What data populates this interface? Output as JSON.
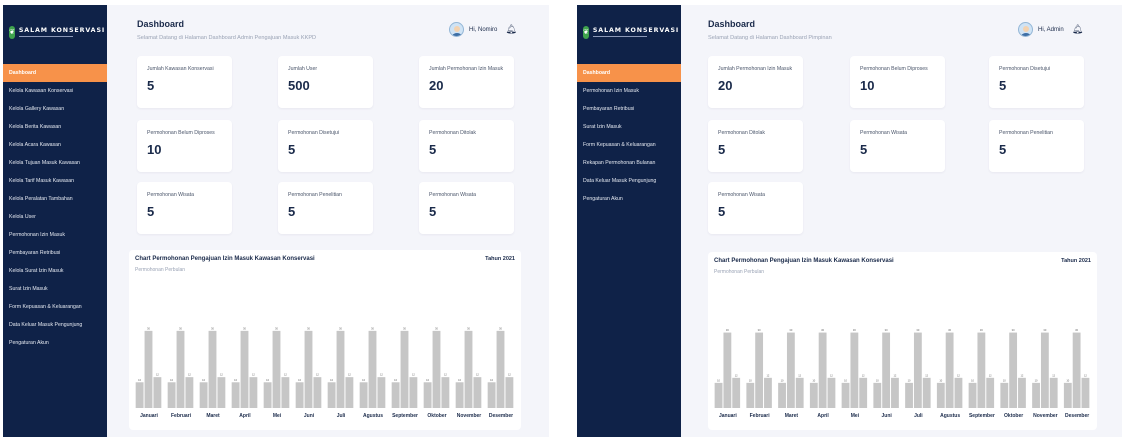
{
  "brand": {
    "name": "SALAM KONSERVASI",
    "logo_icon": "leaf-icon"
  },
  "colors": {
    "sidebar": "#0f2248",
    "active": "#f7924a",
    "bar": "#c6c6c6",
    "text": "#1a2a4a"
  },
  "panel1": {
    "title": "Dashboard",
    "subtitle": "Selamat Datang di Halaman Dashboard Admin Pengajuan Masuk KKPD",
    "greeting": "Hi, Nomiro",
    "menu": [
      "Dashboard",
      "Kelola Kawasan Konservasi",
      "Kelola Gallery Kawasan",
      "Kelola Berita Kawasan",
      "Kelola Acara Kawasan",
      "Kelola Tujuan Masuk Kawasan",
      "Kelola Tarif Masuk Kawasan",
      "Kelola Peralatan Tambahan",
      "Kelola User",
      "Permohonan Izin Masuk",
      "Pembayaran Retribusi",
      "Kelola Surat Izin Masuk",
      "Surat Izin Masuk",
      "Form Kepuasan & Keluarangan",
      "Data Keluar Masuk Pengunjung",
      "Pengaturan Akun"
    ],
    "cards": [
      {
        "label": "Jumlah Kawasan Konservasi",
        "value": "5"
      },
      {
        "label": "Jumlah User",
        "value": "500"
      },
      {
        "label": "Jumlah Permohonan Izin Masuk",
        "value": "20"
      },
      {
        "label": "Permohonan Belum Diproses",
        "value": "10"
      },
      {
        "label": "Permohonan Disetujui",
        "value": "5"
      },
      {
        "label": "Permohonan Ditolak",
        "value": "5"
      },
      {
        "label": "Permohonan Wisata",
        "value": "5"
      },
      {
        "label": "Permohonan Penelitian",
        "value": "5"
      },
      {
        "label": "Permohonan Wisata",
        "value": "5"
      }
    ],
    "chart_title": "Chart Permohonan Pengajuan Izin Masuk Kawasan Konservasi",
    "chart_year": "Tahun 2021",
    "chart_sub": "Permohonan Perbulan"
  },
  "panel2": {
    "title": "Dashboard",
    "subtitle": "Selamat Datang di Halaman Dashboard Pimpinan",
    "greeting": "Hi, Admin",
    "menu": [
      "Dashboard",
      "Permohonan Izin Masuk",
      "Pembayaran Retribusi",
      "Surat Izin Masuk",
      "Form Kepuasan & Keluarangan",
      "Rekapan Permohonan Bulanan",
      "Data Keluar Masuk Pengunjung",
      "Pengaturan Akun"
    ],
    "cards": [
      {
        "label": "Jumlah Permohonan Izin Masuk",
        "value": "20"
      },
      {
        "label": "Permohonan Belum Diproses",
        "value": "10"
      },
      {
        "label": "Permohonan Disetujui",
        "value": "5"
      },
      {
        "label": "Permohonan Ditolak",
        "value": "5"
      },
      {
        "label": "Permohonan Wisata",
        "value": "5"
      },
      {
        "label": "Permohonan Penelitian",
        "value": "5"
      },
      {
        "label": "Permohonan Wisata",
        "value": "5"
      }
    ],
    "chart_title": "Chart Permohonan Pengajuan Izin Masuk Kawasan Konservasi",
    "chart_year": "Tahun 2021",
    "chart_sub": "Permohonan Perbulan"
  },
  "chart_data": {
    "type": "bar",
    "categories": [
      "Januari",
      "Februari",
      "Maret",
      "April",
      "Mei",
      "Juni",
      "Juli",
      "Agustus",
      "September",
      "Oktober",
      "November",
      "Desember"
    ],
    "series": [
      {
        "values": [
          10,
          10,
          10,
          10,
          10,
          10,
          10,
          10,
          10,
          10,
          10,
          10
        ]
      },
      {
        "values": [
          30,
          30,
          30,
          30,
          30,
          30,
          30,
          30,
          30,
          30,
          30,
          30
        ]
      },
      {
        "values": [
          12,
          12,
          12,
          12,
          12,
          12,
          12,
          12,
          12,
          12,
          12,
          12
        ]
      }
    ],
    "ylim": [
      0,
      35
    ],
    "grid": false,
    "legend": "none"
  }
}
